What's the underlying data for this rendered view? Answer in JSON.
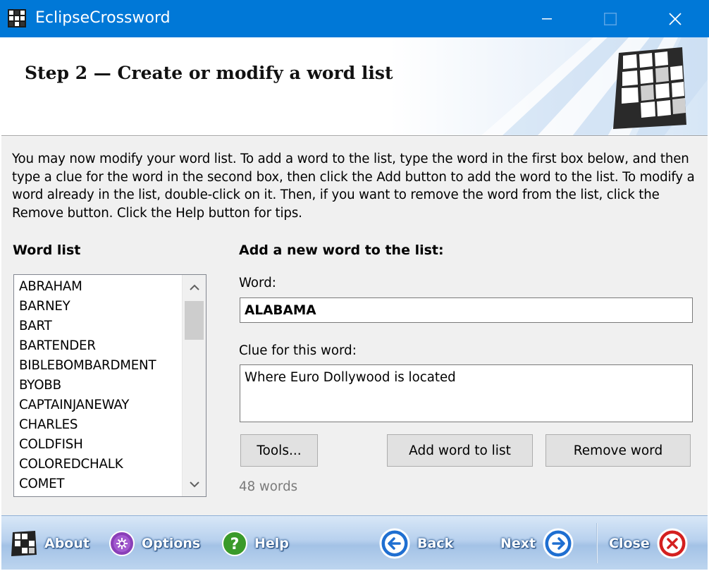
{
  "window": {
    "title": "EclipseCrossword",
    "controls": [
      "minimize",
      "maximize",
      "close"
    ]
  },
  "banner": {
    "step_title": "Step 2 — Create or modify a word list"
  },
  "intro": "You may now modify your word list.  To add a word to the list, type the word in the first box below, and then type a clue for the word in the second box, then click the Add button to add the word to the list.  To modify a word already in the list, double-click on it.  Then, if you want to remove the word from the list, click the Remove button.  Click the Help button for tips.",
  "word_list": {
    "heading": "Word list",
    "items": [
      "ABRAHAM",
      "BARNEY",
      "BART",
      "BARTENDER",
      "BIBLEBOMBARDMENT",
      "BYOBB",
      "CAPTAINJANEWAY",
      "CHARLES",
      "COLDFISH",
      "COLOREDCHALK",
      "COMET"
    ],
    "count_label": "48 words"
  },
  "add_word": {
    "heading": "Add a new word to the list:",
    "word_label": "Word:",
    "word_value": "ALABAMA",
    "clue_label": "Clue for this word:",
    "clue_value": "Where Euro Dollywood is located"
  },
  "buttons": {
    "tools": "Tools...",
    "add": "Add word to list",
    "remove": "Remove word"
  },
  "toolbar": {
    "about": "About",
    "options": "Options",
    "help": "Help",
    "back": "Back",
    "next": "Next",
    "close": "Close"
  },
  "colors": {
    "titlebar": "#0078d7",
    "dialog_bg": "#f0f0f0",
    "toolbar_blue": "#a3c2e6",
    "options_icon": "#8a3fb8",
    "help_icon": "#3a9a2a",
    "nav_icon": "#1f6fd1",
    "close_icon": "#d42020"
  }
}
